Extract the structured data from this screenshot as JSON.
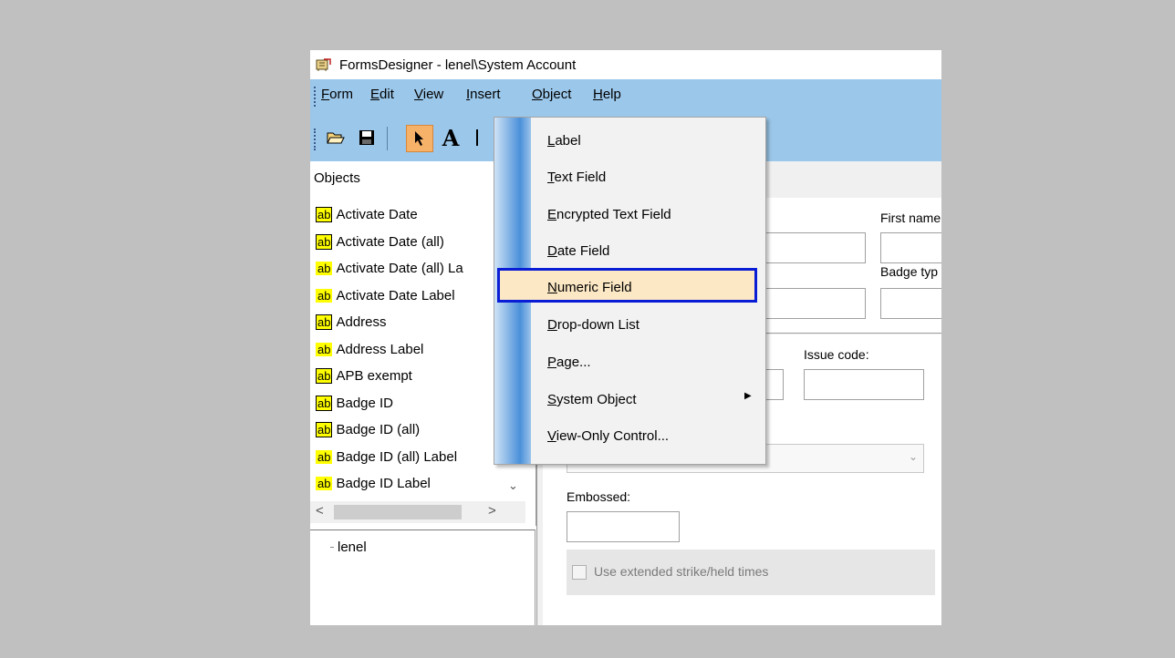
{
  "window": {
    "title": "FormsDesigner - lenel\\System Account"
  },
  "menubar": {
    "items": [
      {
        "hot": "F",
        "rest": "orm"
      },
      {
        "hot": "E",
        "rest": "dit"
      },
      {
        "hot": "V",
        "rest": "iew"
      },
      {
        "hot": "I",
        "rest": "nsert"
      },
      {
        "hot": "O",
        "rest": "bject"
      },
      {
        "hot": "H",
        "rest": "elp"
      }
    ]
  },
  "toolbar": {
    "text_tool_glyph": "A"
  },
  "objects_panel": {
    "title": "Objects",
    "items": [
      {
        "icon": "ab",
        "label": "Activate Date"
      },
      {
        "icon": "ab",
        "label": "Activate Date (all)"
      },
      {
        "icon": "ab",
        "label": "Activate Date (all) La"
      },
      {
        "icon": "ab",
        "label": "Activate Date Label"
      },
      {
        "icon": "ab",
        "label": "Address"
      },
      {
        "icon": "ab",
        "label": "Address Label"
      },
      {
        "icon": "ab",
        "label": "APB exempt"
      },
      {
        "icon": "ab",
        "label": "Badge ID"
      },
      {
        "icon": "ab",
        "label": "Badge ID (all)"
      },
      {
        "icon": "ab",
        "label": "Badge ID (all) Label"
      },
      {
        "icon": "ab",
        "label": "Badge ID Label"
      }
    ]
  },
  "tree_panel": {
    "root": "lenel"
  },
  "form": {
    "first_name_label": "First name",
    "badge_type_label": "Badge typ",
    "issue_code_label": "Issue code:",
    "embossed_label": "Embossed:",
    "extended_strike_label": "Use extended strike/held times"
  },
  "insert_menu": {
    "items": [
      {
        "hot": "L",
        "rest": "abel"
      },
      {
        "hot": "T",
        "rest": "ext Field"
      },
      {
        "hot": "E",
        "rest": "ncrypted Text Field"
      },
      {
        "hot": "D",
        "rest": "ate Field"
      },
      {
        "hot": "N",
        "rest": "umeric Field"
      },
      {
        "hot": "D",
        "rest": "rop-down List"
      },
      {
        "hot": "P",
        "rest": "age..."
      },
      {
        "hot": "S",
        "rest": "ystem Object"
      },
      {
        "hot": "V",
        "rest": "iew-Only Control..."
      }
    ],
    "highlighted": "Numeric Field"
  },
  "colors": {
    "menubar_bg": "#9bc7ea",
    "highlight_border": "#0a1dd6",
    "highlight_fill": "#fce8c4",
    "ab_icon": "#ffff00",
    "active_tool": "#f7b26a"
  }
}
